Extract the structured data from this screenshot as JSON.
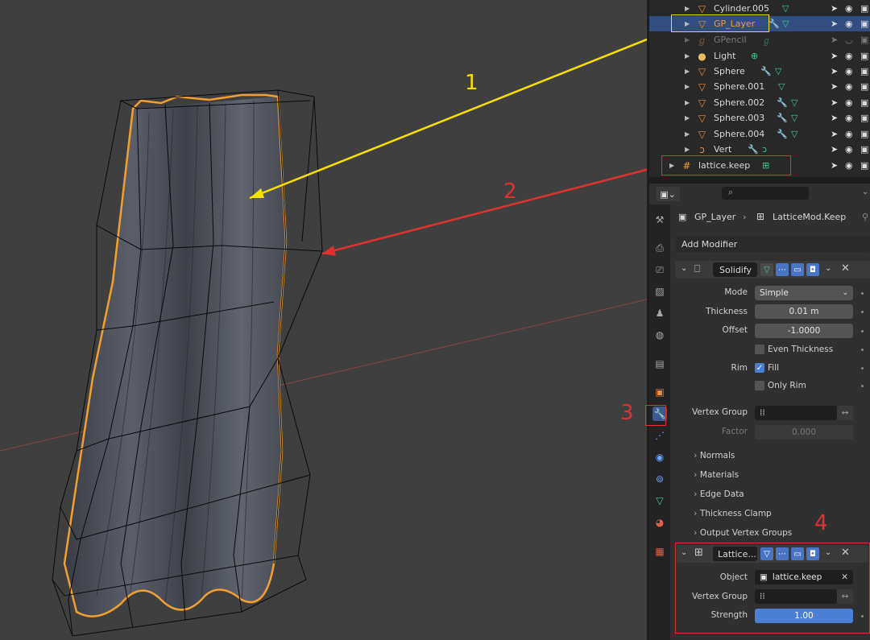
{
  "outliner": {
    "rows": [
      {
        "name": "Cylinder.005",
        "icon": "mesh-icon"
      },
      {
        "name": "GP_Layer",
        "icon": "mesh-icon"
      },
      {
        "name": "GPencil",
        "icon": "gpencil-icon"
      },
      {
        "name": "Light",
        "icon": "light-icon"
      },
      {
        "name": "Sphere",
        "icon": "mesh-icon"
      },
      {
        "name": "Sphere.001",
        "icon": "mesh-icon"
      },
      {
        "name": "Sphere.002",
        "icon": "mesh-icon"
      },
      {
        "name": "Sphere.003",
        "icon": "mesh-icon"
      },
      {
        "name": "Sphere.004",
        "icon": "mesh-icon"
      },
      {
        "name": "Vert",
        "icon": "curve-icon"
      },
      {
        "name": "lattice.keep",
        "icon": "lattice-icon"
      }
    ]
  },
  "properties": {
    "breadcrumb": {
      "object": "GP_Layer",
      "modifier": "LatticeMod.Keep"
    },
    "add_modifier": "Add Modifier",
    "solidify": {
      "name": "Solidify",
      "mode_label": "Mode",
      "mode_value": "Simple",
      "thickness_label": "Thickness",
      "thickness_value": "0.01 m",
      "offset_label": "Offset",
      "offset_value": "-1.0000",
      "even_thickness": "Even Thickness",
      "rim_label": "Rim",
      "fill": "Fill",
      "only_rim": "Only Rim",
      "vertex_group_label": "Vertex Group",
      "factor_label": "Factor",
      "factor_value": "0.000",
      "subpanels": [
        "Normals",
        "Materials",
        "Edge Data",
        "Thickness Clamp",
        "Output Vertex Groups"
      ]
    },
    "lattice": {
      "name": "Lattice...",
      "object_label": "Object",
      "object_value": "lattice.keep",
      "vertex_group_label": "Vertex Group",
      "strength_label": "Strength",
      "strength_value": "1.00"
    }
  },
  "annotations": {
    "a1": "1",
    "a2": "2",
    "a3": "3",
    "a4": "4"
  },
  "colors": {
    "selection": "#324e80",
    "accent_yellow": "#f5e000",
    "accent_red": "#e03030",
    "outline_orange": "#f0a030"
  }
}
